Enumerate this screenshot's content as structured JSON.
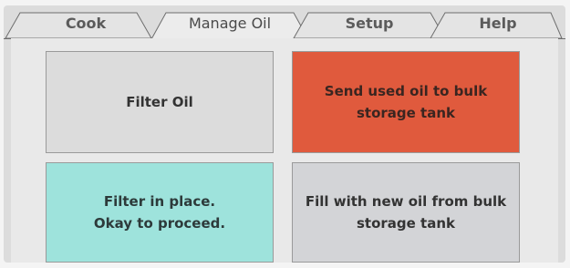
{
  "tabs": [
    {
      "label": "Cook",
      "active": false
    },
    {
      "label": "Manage Oil",
      "active": true
    },
    {
      "label": "Setup",
      "active": false
    },
    {
      "label": "Help",
      "active": false
    }
  ],
  "tiles": {
    "filter_oil": "Filter Oil",
    "send_used_oil": "Send used oil to bulk\nstorage tank",
    "filter_in_place": "Filter in place.\nOkay to proceed.",
    "fill_new_oil": "Fill with new oil from bulk\nstorage tank"
  },
  "colors": {
    "screen_bg": "#dcdcdc",
    "panel_bg": "#e9e9e9",
    "send_oil_tile": "#e05a3d",
    "filter_place_tile": "#9ee3dc",
    "neutral_tile": "#dcdcdc",
    "fill_oil_tile": "#d3d4d7"
  }
}
